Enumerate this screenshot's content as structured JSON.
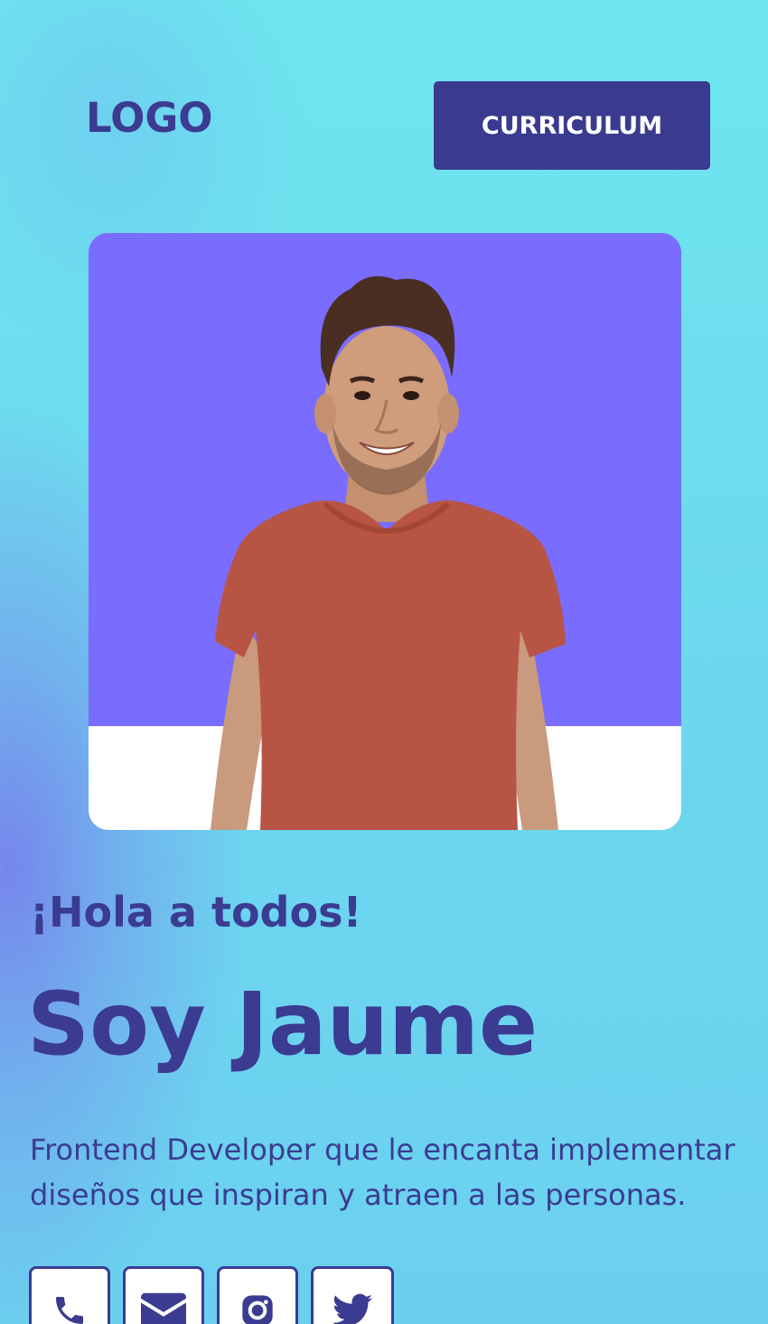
{
  "header": {
    "logo_text": "LOGO",
    "cv_button_label": "CURRICULUM"
  },
  "hero": {
    "photo_icon": "profile-photo",
    "greeting": "¡Hola a todos!",
    "name": "Soy Jaume",
    "tagline": "Frontend Developer que le encanta implementar diseños que inspiran y atraen a las personas."
  },
  "socials": [
    {
      "icon": "phone-icon"
    },
    {
      "icon": "mail-icon"
    },
    {
      "icon": "instagram-icon"
    },
    {
      "icon": "twitter-icon"
    }
  ],
  "colors": {
    "primary": "#3b3b92",
    "photo_background": "#7a6cff",
    "page_gradient_top": "#6ee6ef",
    "page_gradient_accent": "#7a7ae8"
  }
}
